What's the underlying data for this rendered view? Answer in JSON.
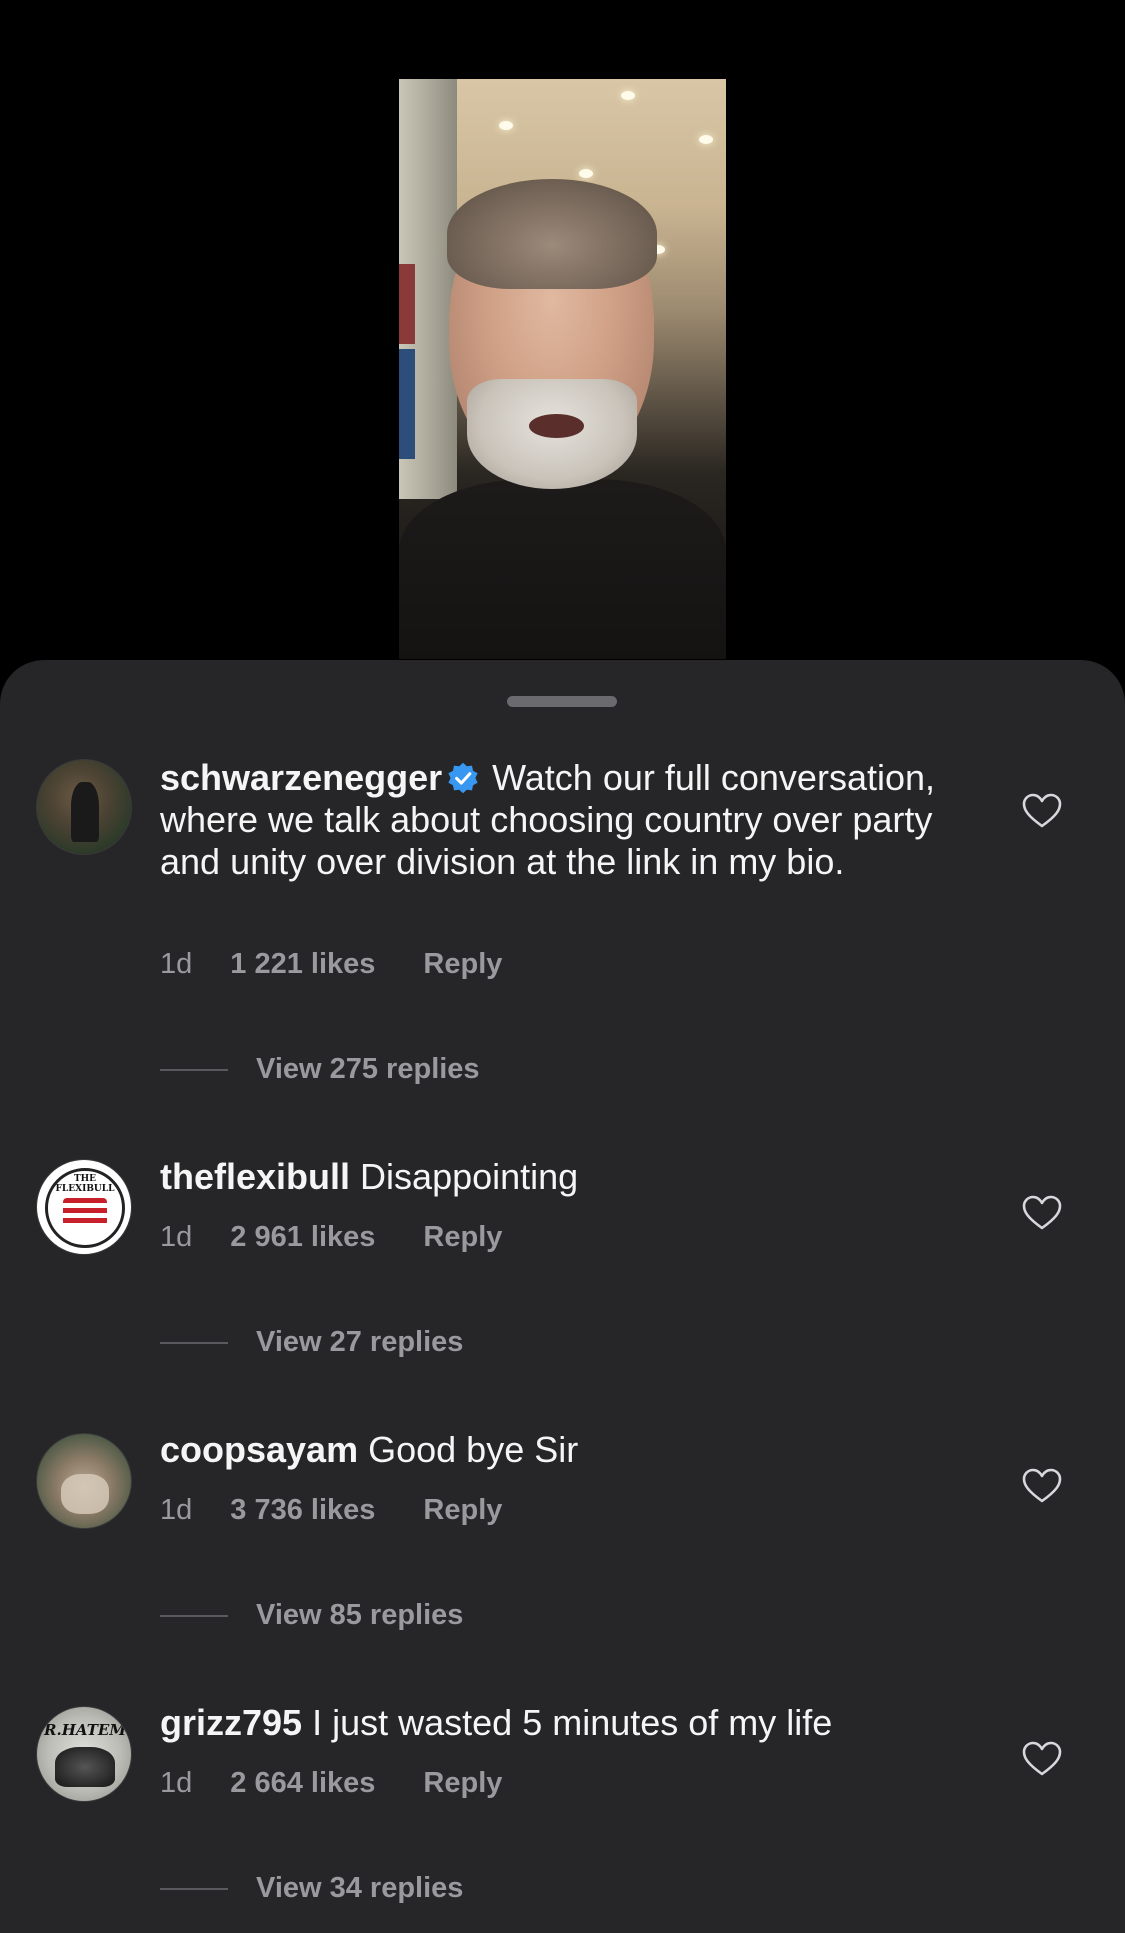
{
  "comments": [
    {
      "username": "schwarzenegger",
      "verified": true,
      "text": "Watch our full conversation, where we talk about choosing country over party and unity over division at the link in my bio.",
      "time": "1d",
      "likes": "1 221 likes",
      "reply_label": "Reply",
      "view_replies": "View 275 replies"
    },
    {
      "username": "theflexibull",
      "avatar_text": "THE FLEXIBULL",
      "text": "Disappointing",
      "time": "1d",
      "likes": "2 961 likes",
      "reply_label": "Reply",
      "view_replies": "View 27 replies"
    },
    {
      "username": "coopsayam",
      "text": "Good bye Sir",
      "time": "1d",
      "likes": "3 736 likes",
      "reply_label": "Reply",
      "view_replies": "View 85 replies"
    },
    {
      "username": "grizz795",
      "avatar_text": "R.HATEM",
      "text": "I just wasted 5 minutes of my life",
      "time": "1d",
      "likes": "2 664 likes",
      "reply_label": "Reply",
      "view_replies": "View 34 replies"
    }
  ],
  "icons": {
    "like": "heart-outline-icon",
    "verified": "verified-badge-icon"
  },
  "colors": {
    "background": "#000000",
    "sheet": "#262628",
    "text_primary": "#f5f5f5",
    "text_secondary": "#9a9a9e",
    "verified_blue": "#3897f0"
  }
}
